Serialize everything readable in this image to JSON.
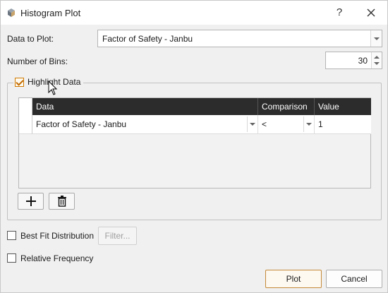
{
  "window": {
    "title": "Histogram Plot",
    "help_glyph": "?",
    "close_glyph": "✕"
  },
  "data_to_plot": {
    "label": "Data to Plot:",
    "value": "Factor of Safety - Janbu"
  },
  "bins": {
    "label": "Number of Bins:",
    "value": "30"
  },
  "highlight": {
    "label": "Highlight Data",
    "checked": true,
    "columns": [
      "Data",
      "Comparison",
      "Value"
    ],
    "rows": [
      {
        "data": "Factor of Safety - Janbu",
        "comparison": "<",
        "value": "1"
      }
    ]
  },
  "best_fit": {
    "label": "Best Fit Distribution",
    "checked": false,
    "filter_label": "Filter..."
  },
  "relative_frequency": {
    "label": "Relative Frequency",
    "checked": false
  },
  "footer": {
    "plot_label": "Plot",
    "cancel_label": "Cancel"
  },
  "colors": {
    "accent": "#c58a3a",
    "header_bg": "#2c2c2c",
    "window_bg": "#f0f0f0"
  }
}
